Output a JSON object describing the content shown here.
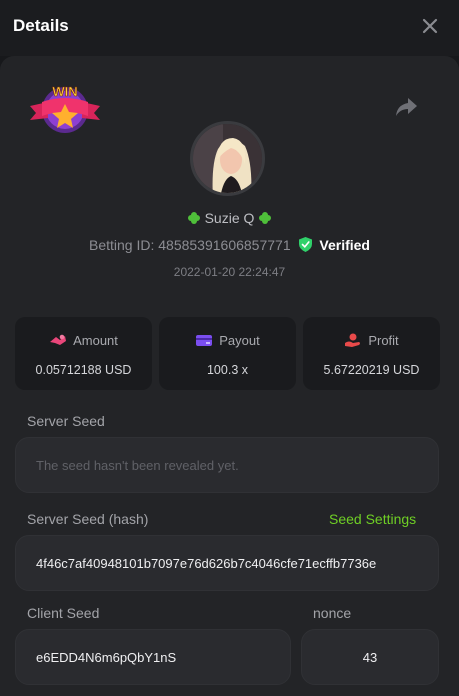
{
  "header": {
    "title": "Details"
  },
  "icons": {
    "close": "close-icon",
    "share": "share-icon",
    "win_badge": "win-badge-icon",
    "clover": "clover-icon",
    "verified": "shield-check-icon"
  },
  "colors": {
    "accent_green": "#6fcf25",
    "verified_green": "#2fd16a",
    "amount_icon": "#e9467a",
    "payout_icon": "#7b4ef0",
    "profit_icon": "#e94a4a"
  },
  "user": {
    "name": "Suzie Q",
    "betting_label": "Betting ID:",
    "betting_id": "48585391606857771",
    "verified": "Verified",
    "timestamp": "2022-01-20 22:24:47"
  },
  "badge": {
    "text": "WIN"
  },
  "stats": {
    "amount": {
      "label": "Amount",
      "value": "0.05712188 USD"
    },
    "payout": {
      "label": "Payout",
      "value": "100.3 x"
    },
    "profit": {
      "label": "Profit",
      "value": "5.67220219 USD"
    }
  },
  "seeds": {
    "server_seed_label": "Server Seed",
    "server_seed_placeholder": "The seed hasn't been revealed yet.",
    "server_hash_label": "Server Seed (hash)",
    "seed_settings": "Seed Settings",
    "server_hash_value": "4f46c7af40948101b7097e76d626b7c4046cfe71ecffb7736e",
    "client_seed_label": "Client Seed",
    "client_seed_value": "e6EDD4N6m6pQbY1nS",
    "nonce_label": "nonce",
    "nonce_value": "43"
  }
}
